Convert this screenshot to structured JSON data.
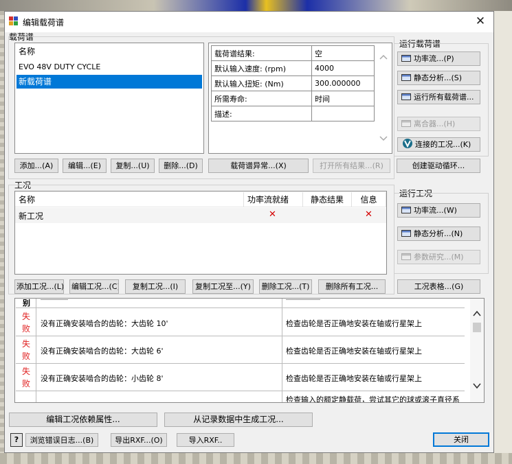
{
  "window": {
    "title": "编辑载荷谱",
    "close_symbol": "✕"
  },
  "duty_cycle_group": {
    "label": "载荷谱",
    "list_header": "名称",
    "items": [
      "EVO 48V DUTY CYCLE",
      "新载荷谱"
    ],
    "selected_index": 1,
    "properties": [
      {
        "name": "载荷谱结果:",
        "value": "空"
      },
      {
        "name": "默认输入速度: (rpm)",
        "value": "4000"
      },
      {
        "name": "默认输入扭矩: (Nm)",
        "value": "300.000000"
      },
      {
        "name": "所需寿命:",
        "value": "时间"
      },
      {
        "name": "描述:",
        "value": ""
      }
    ],
    "buttons": {
      "add": "添加...(A)",
      "edit": "编辑...(E)",
      "copy": "复制...(U)",
      "delete": "删除...(D)",
      "anomaly": "载荷谱异常...(X)",
      "open_all_results": "打开所有结果...(R)",
      "create_drive_cycle": "创建驱动循环..."
    }
  },
  "run_duty_cycle_group": {
    "label": "运行载荷谱",
    "power_flow": "功率流...(P)",
    "static_analysis": "静态分析...(S)",
    "run_all": "运行所有载荷谱...",
    "clutch": "离合器...(H)",
    "connected_load_cases": "连接的工况...(K)"
  },
  "load_case_group": {
    "label": "工况",
    "columns": [
      "名称",
      "功率流就绪",
      "静态结果",
      "信息"
    ],
    "rows": [
      {
        "name": "新工况",
        "power_flow_ready": "✕",
        "static_result": "",
        "info": "✕"
      }
    ],
    "buttons": {
      "add": "添加工况...(L)",
      "edit": "编辑工况...(C)",
      "copy": "复制工况...(I)",
      "copy_to": "复制工况至...(Y)",
      "delete": "删除工况...(T)",
      "delete_all": "删除所有工况...",
      "table": "工况表格...(G)"
    }
  },
  "run_load_case_group": {
    "label": "运行工况",
    "power_flow": "功率流...(W)",
    "static_analysis": "静态分析...(N)",
    "parametric_study": "参数研究...(M)"
  },
  "messages": {
    "partial_header": "别",
    "rows": [
      {
        "status": "失败",
        "text": "没有正确安装啮合的齿轮：大齿轮 10'",
        "solution": "检查齿轮是否正确地安装在轴或行星架上"
      },
      {
        "status": "失败",
        "text": "没有正确安装啮合的齿轮：大齿轮 6'",
        "solution": "检查齿轮是否正确地安装在轴或行星架上"
      },
      {
        "status": "失败",
        "text": "没有正确安装啮合的齿轮：小齿轮 8'",
        "solution": "检查齿轮是否正确地安装在轴或行星架上"
      },
      {
        "status": "",
        "text": "",
        "solution": "检查输入的额定静载荷，尝试其它的球或滚子直径系"
      }
    ]
  },
  "footer": {
    "edit_dependent_props": "编辑工况依赖属性...",
    "generate_from_log": "从记录数据中生成工况...",
    "help": "?",
    "browse_error_log": "浏览错误日志...(B)",
    "export_rxf": "导出RXF...(O)",
    "import_rxf": "导入RXF..",
    "close": "关闭"
  }
}
